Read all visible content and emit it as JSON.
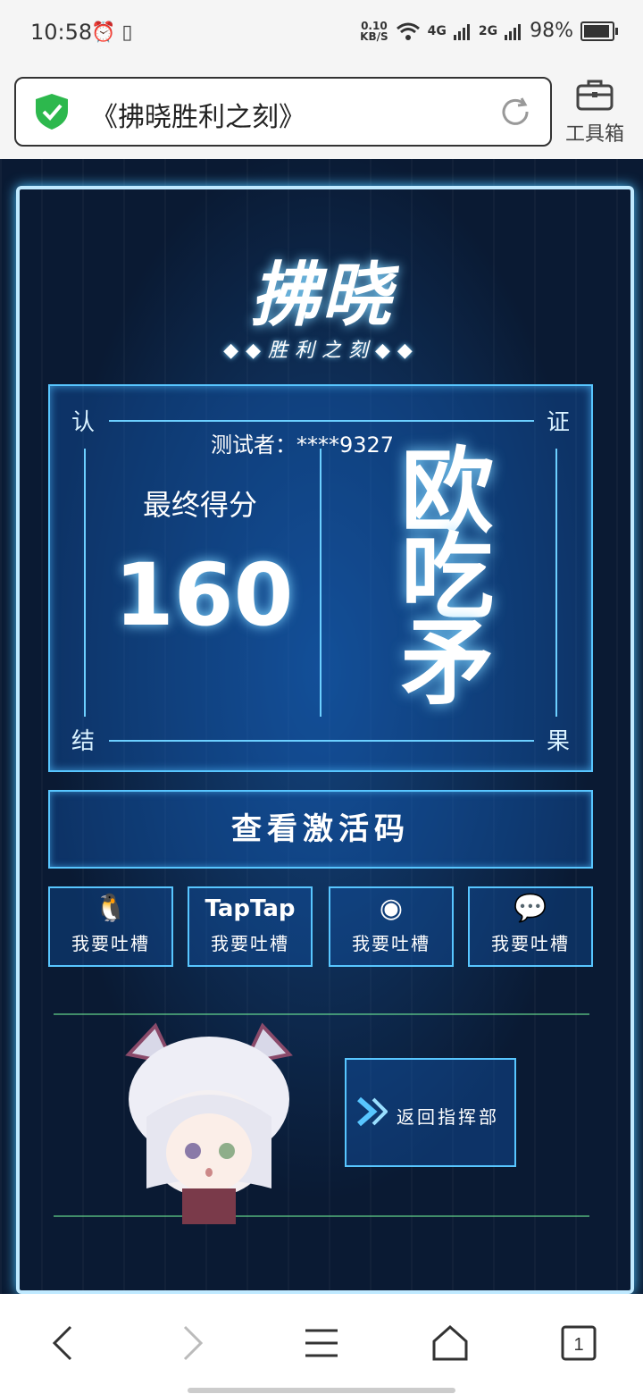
{
  "status_bar": {
    "time": "10:58",
    "icons": "⏰ ▯",
    "speed_value": "0.10",
    "speed_unit": "KB/S",
    "net1": "4G",
    "net2": "2G",
    "battery": "98%",
    "battery_level": 0.98
  },
  "browser": {
    "url_title": "《拂晓胜利之刻》",
    "toolbox_label": "工具箱"
  },
  "game": {
    "logo_main": "拂晓",
    "logo_sub": "◆◆胜利之刻◆◆",
    "corners": {
      "tl": "认",
      "tr": "证",
      "bl": "结",
      "br": "果"
    },
    "tester": "测试者：****9327",
    "score_label": "最终得分",
    "score_value": "160",
    "result": "欧吃矛",
    "activation_button": "查看激活码",
    "shares": [
      {
        "icon": "qq-icon",
        "icon_text": "🐧",
        "label": "我要吐槽"
      },
      {
        "icon": "taptap-icon",
        "icon_text": "TapTap",
        "label": "我要吐槽"
      },
      {
        "icon": "weibo-icon",
        "icon_text": "◉",
        "label": "我要吐槽"
      },
      {
        "icon": "wechat-icon",
        "icon_text": "💬",
        "label": "我要吐槽"
      }
    ],
    "back_button": "返回指挥部"
  },
  "colors": {
    "accent": "#58c6ff",
    "bg": "#0a1a33",
    "shield": "#2db84d"
  }
}
